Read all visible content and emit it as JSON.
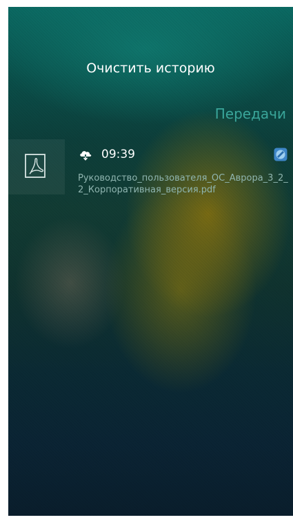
{
  "pulley_menu": {
    "clear_history_label": "Очистить историю"
  },
  "page": {
    "title": "Передачи",
    "accent_color": "#3aa69a"
  },
  "transfers": [
    {
      "direction_icon": "cloud-download-icon",
      "time": "09:39",
      "file_name": "Руководство_пользователя_ОС_Аврора_3_2_2_Корпоративная_версия.pdf",
      "file_type_icon": "pdf-file-icon",
      "service_icon": "sync-service-icon"
    }
  ]
}
